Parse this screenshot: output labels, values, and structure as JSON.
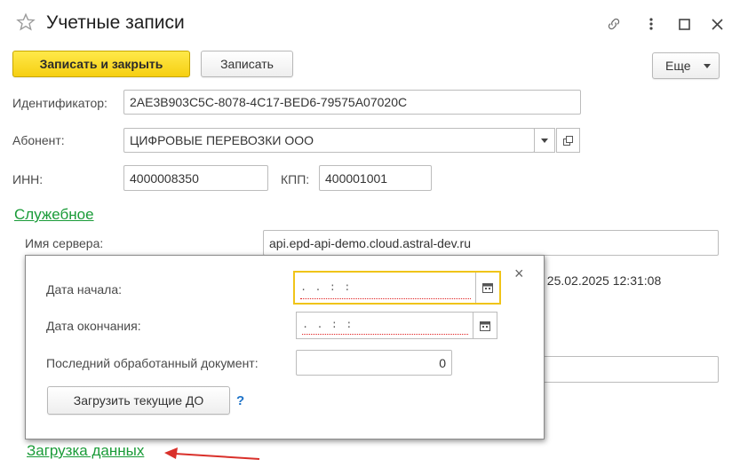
{
  "window": {
    "title": "Учетные записи"
  },
  "toolbar": {
    "save_close_label": "Записать и закрыть",
    "save_label": "Записать",
    "more_label": "Еще"
  },
  "form": {
    "identifier_label": "Идентификатор:",
    "identifier_value": "2AE3B903C5C-8078-4C17-BED6-79575A07020C",
    "subscriber_label": "Абонент:",
    "subscriber_value": "ЦИФРОВЫЕ ПЕРЕВОЗКИ ООО",
    "inn_label": "ИНН:",
    "inn_value": "4000008350",
    "kpp_label": "КПП:",
    "kpp_value": "400001001",
    "service_group_link": "Служебное",
    "server_label": "Имя сервера:",
    "server_value": "api.epd-api-demo.cloud.astral-dev.ru",
    "partial_datetime": ": 25.02.2025 12:31:08",
    "load_data_link": "Загрузка данных"
  },
  "popup": {
    "start_date_label": "Дата начала:",
    "start_date_mask": " .  .      :  :",
    "end_date_label": "Дата окончания:",
    "end_date_mask": " .  .      :  :",
    "last_doc_label": "Последний обработанный документ:",
    "last_doc_value": "0",
    "load_button_label": "Загрузить текущие ДО",
    "help_label": "?",
    "close_label": "×"
  },
  "colors": {
    "primary_button": "#f6cf12",
    "link_green": "#1a9b38",
    "focus_border": "#f0c419",
    "annotation_arrow": "#d9302a",
    "help_blue": "#1e73c8"
  },
  "icons": {
    "favorite": "star-outline-icon",
    "link": "link-icon",
    "menu": "vertical-dots-icon",
    "maximize": "maximize-icon",
    "close": "close-icon",
    "dropdown": "chevron-down-icon",
    "open": "open-form-icon",
    "calendar": "calendar-icon",
    "arrow": "red-arrow-icon"
  }
}
